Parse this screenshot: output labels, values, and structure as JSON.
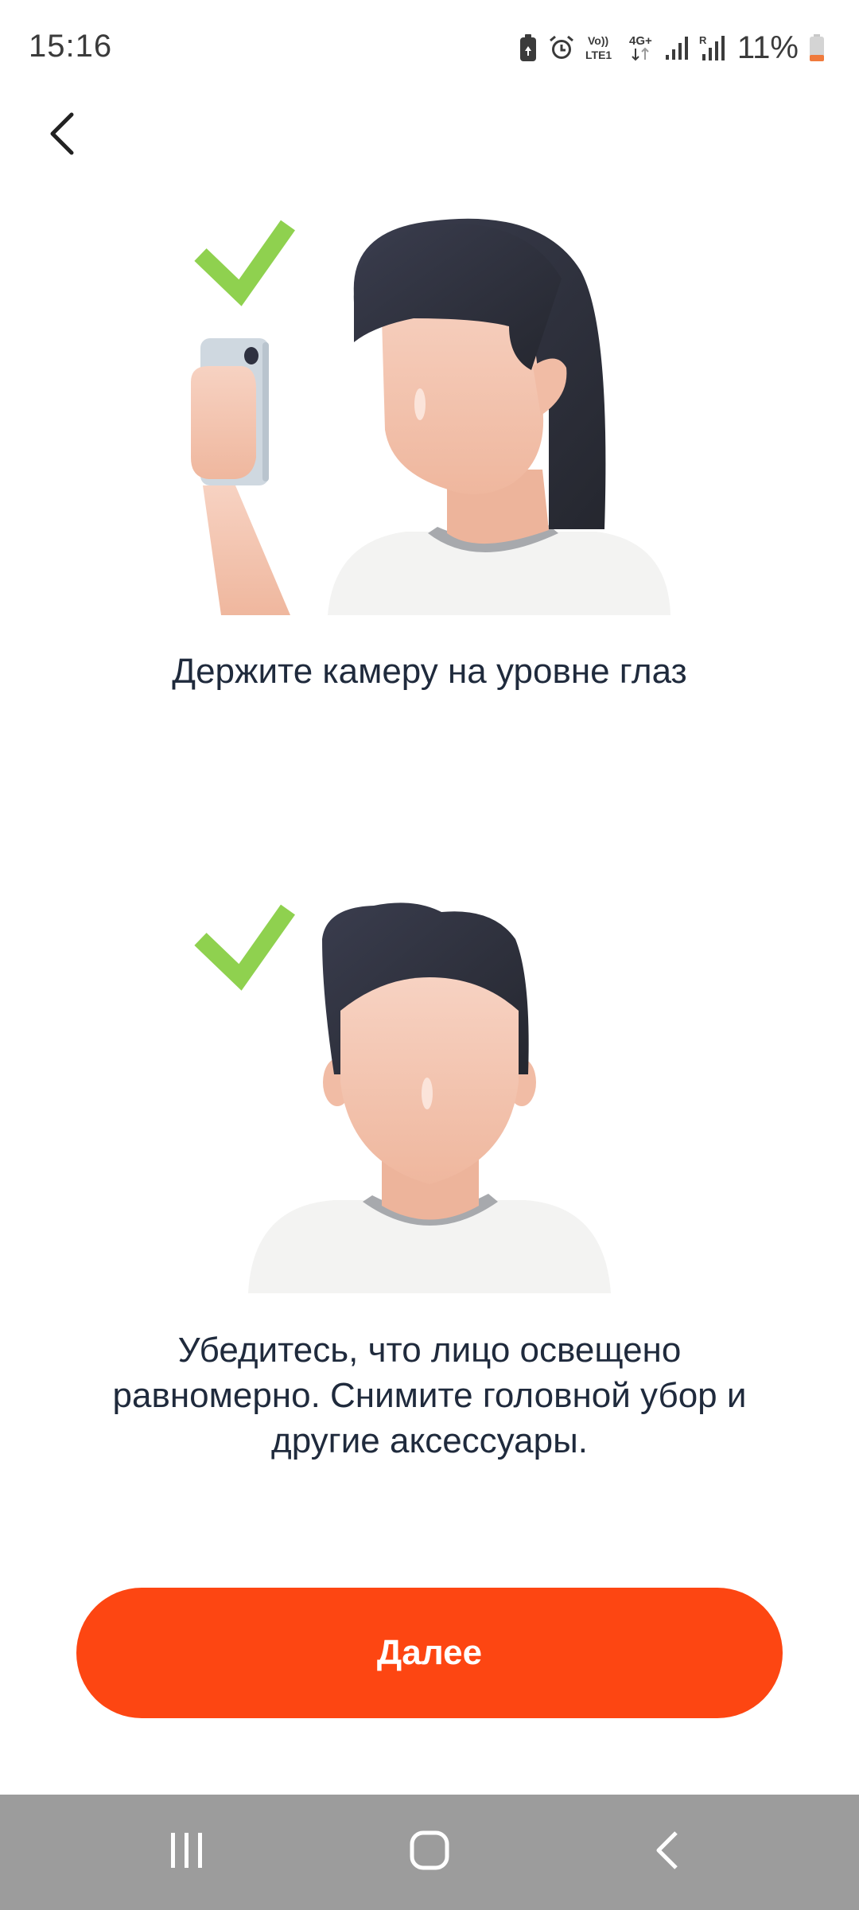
{
  "status_bar": {
    "time": "15:16",
    "battery_percent": "11%",
    "icons": [
      "battery-saver-icon",
      "alarm-icon",
      "volte-lte1-icon",
      "4g-plus-data-icon",
      "signal-strength-icon",
      "signal-roaming-icon",
      "battery-icon"
    ]
  },
  "navigation": {
    "back_icon": "chevron-left-icon"
  },
  "steps": [
    {
      "illustration": "person-holding-phone-at-eye-level",
      "check_icon": "green-check-icon",
      "text": "Держите камеру на уровне глаз"
    },
    {
      "illustration": "person-face-front-evenly-lit",
      "check_icon": "green-check-icon",
      "text": "Убедитесь, что лицо освещено равномерно. Снимите головной убор и другие аксессуары."
    }
  ],
  "primary_button": {
    "label": "Далее",
    "color": "#fd4612"
  },
  "system_nav": {
    "recents_icon": "recents-icon",
    "home_icon": "home-icon",
    "back_icon": "back-icon"
  },
  "colors": {
    "check_green": "#8fd14f",
    "hair": "#2e3140",
    "skin": "#f4c3ad",
    "shirt": "#f3f3f2",
    "collar": "#a7a9ad",
    "phone": "#cfd8e0",
    "text": "#1f2a3c"
  }
}
